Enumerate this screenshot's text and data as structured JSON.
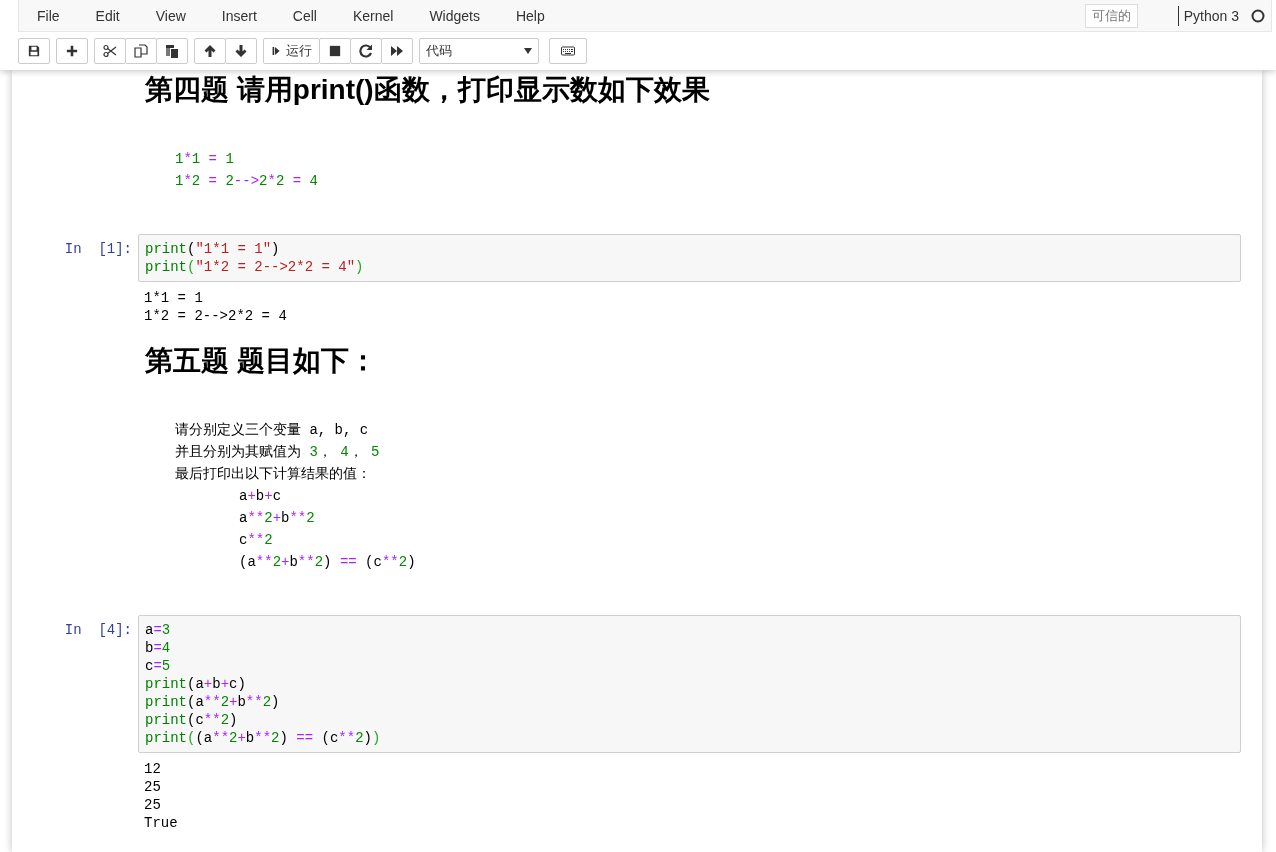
{
  "menubar": {
    "items": [
      "File",
      "Edit",
      "View",
      "Insert",
      "Cell",
      "Kernel",
      "Widgets",
      "Help"
    ],
    "trusted": "可信的",
    "kernel": "Python 3",
    "kernel_busy": false
  },
  "toolbar": {
    "run_label": "运行",
    "cell_type": "代码"
  },
  "cells": [
    {
      "kind": "markdown",
      "blocks": [
        {
          "kind": "heading",
          "text": "第四题 请用print()函数，打印显示数如下效果"
        },
        {
          "kind": "code",
          "lines": [
            {
              "tokens": [
                {
                  "kind": "number",
                  "text": "1"
                },
                {
                  "kind": "operator",
                  "text": "*"
                },
                {
                  "kind": "number",
                  "text": "1"
                },
                {
                  "kind": "operator",
                  "text": " = "
                },
                {
                  "kind": "number",
                  "text": "1"
                }
              ]
            },
            {
              "tokens": [
                {
                  "kind": "number",
                  "text": "1"
                },
                {
                  "kind": "operator",
                  "text": "*"
                },
                {
                  "kind": "number",
                  "text": "2"
                },
                {
                  "kind": "operator",
                  "text": " = "
                },
                {
                  "kind": "number",
                  "text": "2"
                },
                {
                  "kind": "operator",
                  "text": "-->"
                },
                {
                  "kind": "number",
                  "text": "2"
                },
                {
                  "kind": "operator",
                  "text": "*"
                },
                {
                  "kind": "number",
                  "text": "2"
                },
                {
                  "kind": "operator",
                  "text": " = "
                },
                {
                  "kind": "number",
                  "text": "4"
                }
              ]
            }
          ]
        }
      ]
    },
    {
      "kind": "code",
      "prompt": "In  [1]:",
      "lines": [
        {
          "tokens": [
            {
              "kind": "builtin",
              "text": "print"
            },
            {
              "kind": "name",
              "text": "("
            },
            {
              "kind": "string",
              "text": "\"1*1 = 1\""
            },
            {
              "kind": "name",
              "text": ")"
            }
          ]
        },
        {
          "tokens": [
            {
              "kind": "builtin",
              "text": "print"
            },
            {
              "kind": "bracket",
              "text": "("
            },
            {
              "kind": "string",
              "text": "\"1*2 = 2-->2*2 = 4\""
            },
            {
              "kind": "bracket",
              "text": ")"
            }
          ]
        }
      ],
      "output": [
        "1*1 = 1",
        "1*2 = 2-->2*2 = 4"
      ]
    },
    {
      "kind": "markdown",
      "blocks": [
        {
          "kind": "heading",
          "text": "第五题 题目如下："
        },
        {
          "kind": "code",
          "lines": [
            {
              "tokens": [
                {
                  "kind": "name",
                  "text": "请分别定义三个变量 a, b, c"
                }
              ]
            },
            {
              "tokens": [
                {
                  "kind": "name",
                  "text": "并且分别为其赋值为 "
                },
                {
                  "kind": "number",
                  "text": "3"
                },
                {
                  "kind": "name",
                  "text": "， "
                },
                {
                  "kind": "number",
                  "text": "4"
                },
                {
                  "kind": "name",
                  "text": "， "
                },
                {
                  "kind": "number",
                  "text": "5"
                }
              ]
            },
            {
              "tokens": [
                {
                  "kind": "name",
                  "text": "最后打印出以下计算结果的值："
                }
              ],
              "children": [
                {
                  "tokens": [
                    {
                      "kind": "name",
                      "text": "a"
                    },
                    {
                      "kind": "operator",
                      "text": "+"
                    },
                    {
                      "kind": "name",
                      "text": "b"
                    },
                    {
                      "kind": "operator",
                      "text": "+"
                    },
                    {
                      "kind": "name",
                      "text": "c"
                    }
                  ]
                },
                {
                  "tokens": [
                    {
                      "kind": "name",
                      "text": "a"
                    },
                    {
                      "kind": "operator",
                      "text": "**"
                    },
                    {
                      "kind": "number",
                      "text": "2"
                    },
                    {
                      "kind": "operator",
                      "text": "+"
                    },
                    {
                      "kind": "name",
                      "text": "b"
                    },
                    {
                      "kind": "operator",
                      "text": "**"
                    },
                    {
                      "kind": "number",
                      "text": "2"
                    }
                  ]
                },
                {
                  "tokens": [
                    {
                      "kind": "name",
                      "text": "c"
                    },
                    {
                      "kind": "operator",
                      "text": "**"
                    },
                    {
                      "kind": "number",
                      "text": "2"
                    }
                  ]
                },
                {
                  "tokens": [
                    {
                      "kind": "name",
                      "text": "(a"
                    },
                    {
                      "kind": "operator",
                      "text": "**"
                    },
                    {
                      "kind": "number",
                      "text": "2"
                    },
                    {
                      "kind": "operator",
                      "text": "+"
                    },
                    {
                      "kind": "name",
                      "text": "b"
                    },
                    {
                      "kind": "operator",
                      "text": "**"
                    },
                    {
                      "kind": "number",
                      "text": "2"
                    },
                    {
                      "kind": "name",
                      "text": ") "
                    },
                    {
                      "kind": "operator",
                      "text": "=="
                    },
                    {
                      "kind": "name",
                      "text": " (c"
                    },
                    {
                      "kind": "operator",
                      "text": "**"
                    },
                    {
                      "kind": "number",
                      "text": "2"
                    },
                    {
                      "kind": "name",
                      "text": ")"
                    }
                  ]
                }
              ]
            }
          ]
        }
      ]
    },
    {
      "kind": "code",
      "prompt": "In  [4]:",
      "lines": [
        {
          "tokens": [
            {
              "kind": "name",
              "text": "a"
            },
            {
              "kind": "operator",
              "text": "="
            },
            {
              "kind": "number",
              "text": "3"
            }
          ]
        },
        {
          "tokens": [
            {
              "kind": "name",
              "text": "b"
            },
            {
              "kind": "operator",
              "text": "="
            },
            {
              "kind": "number",
              "text": "4"
            }
          ]
        },
        {
          "tokens": [
            {
              "kind": "name",
              "text": "c"
            },
            {
              "kind": "operator",
              "text": "="
            },
            {
              "kind": "number",
              "text": "5"
            }
          ]
        },
        {
          "tokens": [
            {
              "kind": "builtin",
              "text": "print"
            },
            {
              "kind": "name",
              "text": "(a"
            },
            {
              "kind": "operator",
              "text": "+"
            },
            {
              "kind": "name",
              "text": "b"
            },
            {
              "kind": "operator",
              "text": "+"
            },
            {
              "kind": "name",
              "text": "c)"
            }
          ]
        },
        {
          "tokens": [
            {
              "kind": "builtin",
              "text": "print"
            },
            {
              "kind": "name",
              "text": "(a"
            },
            {
              "kind": "operator",
              "text": "**"
            },
            {
              "kind": "number",
              "text": "2"
            },
            {
              "kind": "operator",
              "text": "+"
            },
            {
              "kind": "name",
              "text": "b"
            },
            {
              "kind": "operator",
              "text": "**"
            },
            {
              "kind": "number",
              "text": "2"
            },
            {
              "kind": "name",
              "text": ")"
            }
          ]
        },
        {
          "tokens": [
            {
              "kind": "builtin",
              "text": "print"
            },
            {
              "kind": "name",
              "text": "(c"
            },
            {
              "kind": "operator",
              "text": "**"
            },
            {
              "kind": "number",
              "text": "2"
            },
            {
              "kind": "name",
              "text": ")"
            }
          ]
        },
        {
          "tokens": [
            {
              "kind": "builtin",
              "text": "print"
            },
            {
              "kind": "bracket",
              "text": "("
            },
            {
              "kind": "name",
              "text": "(a"
            },
            {
              "kind": "operator",
              "text": "**"
            },
            {
              "kind": "number",
              "text": "2"
            },
            {
              "kind": "operator",
              "text": "+"
            },
            {
              "kind": "name",
              "text": "b"
            },
            {
              "kind": "operator",
              "text": "**"
            },
            {
              "kind": "number",
              "text": "2"
            },
            {
              "kind": "name",
              "text": ") "
            },
            {
              "kind": "operator",
              "text": "=="
            },
            {
              "kind": "name",
              "text": " (c"
            },
            {
              "kind": "operator",
              "text": "**"
            },
            {
              "kind": "number",
              "text": "2"
            },
            {
              "kind": "name",
              "text": ")"
            },
            {
              "kind": "bracket",
              "text": ")"
            }
          ]
        }
      ],
      "output": [
        "12",
        "25",
        "25",
        "True"
      ]
    }
  ]
}
